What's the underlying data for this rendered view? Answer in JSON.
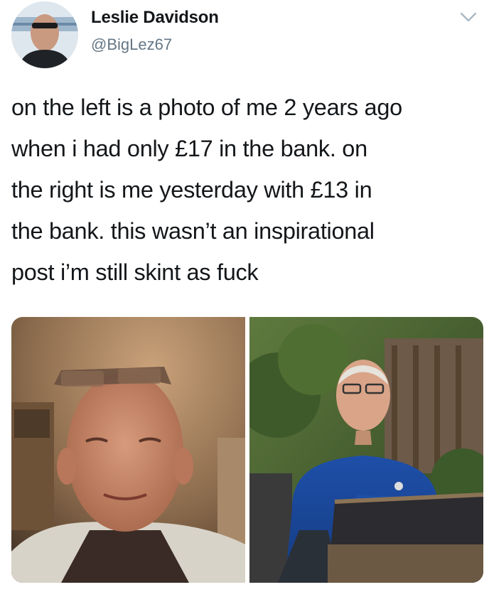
{
  "user": {
    "display_name": "Leslie Davidson",
    "handle": "@BigLez67",
    "avatar_icon": "profile-photo"
  },
  "menu": {
    "icon": "chevron-down-icon"
  },
  "tweet": {
    "lines": [
      "on the left is a photo of me 2 years ago",
      "when i had only £17 in the bank. on",
      "the right is me yesterday with £13 in",
      "the bank. this wasn’t an inspirational",
      "post i’m still skint as fuck"
    ]
  },
  "media": {
    "photos": [
      {
        "name": "photo-left",
        "subject": "selfie indoors"
      },
      {
        "name": "photo-right",
        "subject": "man in blue shirt in garden"
      }
    ]
  },
  "colors": {
    "text": "#14171a",
    "secondary": "#657786",
    "background": "#ffffff"
  }
}
